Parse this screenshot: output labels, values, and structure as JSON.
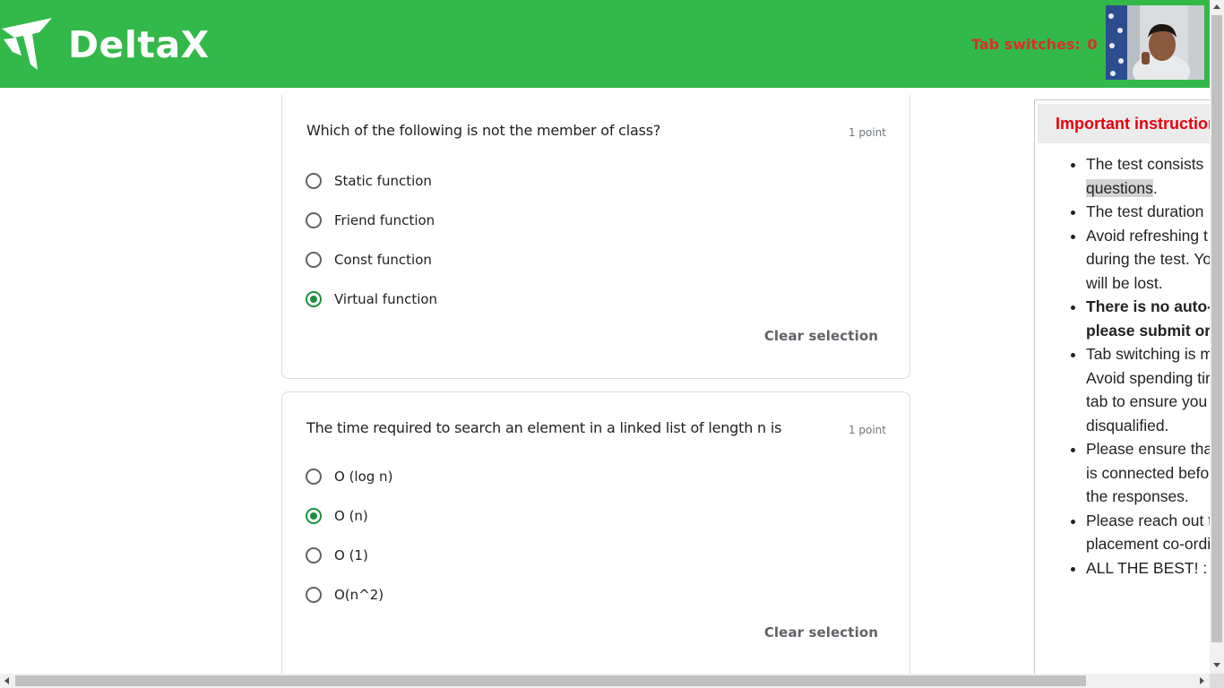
{
  "header": {
    "brand": "DeltaX",
    "tab_switches_label": "Tab switches:",
    "tab_switches_count": "0",
    "background_color": "#33b84a"
  },
  "questions": [
    {
      "text": "Which of the following is not the member of class?",
      "points": "1 point",
      "options": [
        "Static function",
        "Friend function",
        "Const function",
        "Virtual function"
      ],
      "selected": "Virtual function",
      "clear_label": "Clear selection"
    },
    {
      "text": "The time required to search an element in a linked list of length n is",
      "points": "1 point",
      "options": [
        "O (log n)",
        "O (n)",
        "O (1)",
        "O(n^2)"
      ],
      "selected": "O (n)",
      "clear_label": "Clear selection"
    }
  ],
  "instructions": {
    "title": "Important instructions",
    "items": [
      {
        "lines": [
          "The test consists",
          "questions."
        ],
        "highlight_word": "questions"
      },
      {
        "lines": [
          "The test duration"
        ]
      },
      {
        "lines": [
          "Avoid refreshing t",
          "during the test. Yo",
          "will be lost."
        ]
      },
      {
        "lines": [
          "There is no auto-",
          "please submit or"
        ],
        "bold": true
      },
      {
        "lines": [
          "Tab switching is m",
          "Avoid spending tir",
          "tab to ensure you",
          "disqualified."
        ]
      },
      {
        "lines": [
          "Please ensure tha",
          "is connected befo",
          "the responses."
        ]
      },
      {
        "lines": [
          "Please reach out t",
          "placement co-ordi"
        ]
      },
      {
        "lines": [
          "ALL THE BEST! :"
        ]
      }
    ]
  },
  "colors": {
    "accent_radio": "#1e8e3e",
    "tab_switch_text": "#d93025",
    "instruction_title": "#e8000b"
  }
}
